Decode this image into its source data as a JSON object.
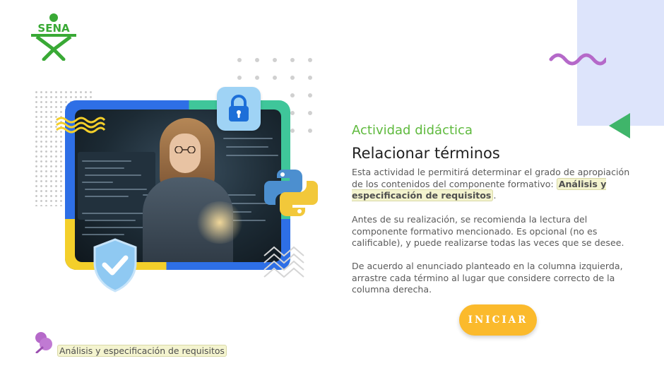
{
  "brand": {
    "logo_text": "SENA",
    "logo_color": "#39a935"
  },
  "activity": {
    "subtitle": "Actividad didáctica",
    "title": "Relacionar términos",
    "intro_before": "Esta actividad le permitirá determinar el grado de apropiación de los contenidos del componente formativo: ",
    "intro_highlight": "Análisis y especificación de requisitos",
    "intro_after": ".",
    "recommendation": "Antes de su realización, se recomienda la lectura del componente formativo mencionado.  Es opcional (no es calificable), y puede realizarse todas las veces que se desee.",
    "instructions": "De acuerdo al enunciado planteado en la columna izquierda, arrastre cada término al lugar que considere correcto de la columna derecha."
  },
  "start_button": {
    "label": "INICIAR",
    "color": "#fbba2c"
  },
  "footer": {
    "component_label": "Análisis y especificación de requisitos"
  },
  "colors": {
    "accent_green": "#5fba3e",
    "lavender": "#dde4fb",
    "purple": "#b569c9",
    "highlight_bg": "#f4f4cf"
  },
  "icons": {
    "logo": "sena-logo-icon",
    "lock": "lock-icon",
    "shield": "shield-check-icon",
    "python": "python-logo-icon",
    "pin": "pushpin-icon"
  }
}
